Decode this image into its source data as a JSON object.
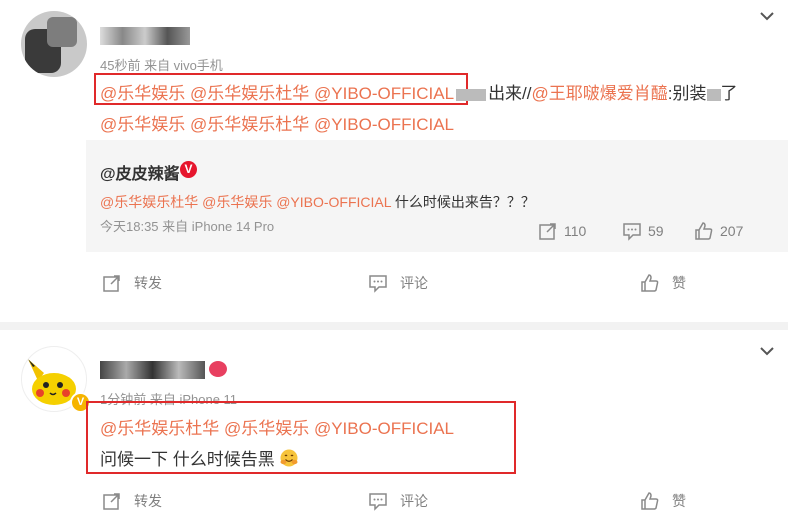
{
  "post1": {
    "meta": "45秒前  来自 vivo手机",
    "line1_mentions": [
      "@乐华娱乐",
      "@乐华娱乐杜华",
      "@YIBO-OFFICIAL"
    ],
    "line1_mid": "出来//",
    "line1_mention2": "@王耶啵爆爱肖醯",
    "line1_tail": ":别装",
    "line1_end": "了",
    "line2": "@乐华娱乐 @乐华娱乐杜华 @YIBO-OFFICIAL"
  },
  "quote": {
    "author": "@皮皮辣酱",
    "mentions": "@乐华娱乐杜华 @乐华娱乐 @YIBO-OFFICIAL",
    "text": " 什么时候出来告？？？",
    "meta": "今天18:35 来自 iPhone 14 Pro",
    "reposts": "110",
    "comments": "59",
    "likes": "207"
  },
  "actions1": {
    "repost": "转发",
    "comment": "评论",
    "like": "赞"
  },
  "post2": {
    "meta": "1分钟前  来自 iPhone 11",
    "mentions": "@乐华娱乐杜华 @乐华娱乐 @YIBO-OFFICIAL",
    "text": "问候一下 什么时候告黑"
  },
  "actions2": {
    "repost": "转发",
    "comment": "评论",
    "like": "赞"
  },
  "colors": {
    "mention": "#eb7350",
    "highlight_box": "#e0292a"
  }
}
